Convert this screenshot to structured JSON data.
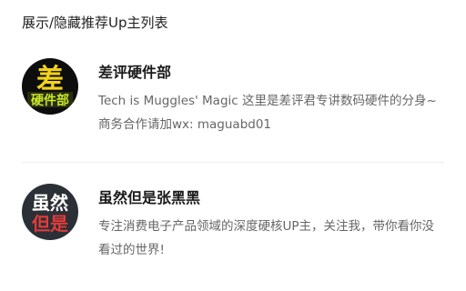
{
  "section": {
    "title": "展示/隐藏推荐Up主列表"
  },
  "ups": [
    {
      "name": "差评硬件部",
      "description": "Tech is Muggles' Magic 这里是差评君专讲数码硬件的分身~ 商务合作请加wx: maguabd01",
      "avatar": {
        "icon": "chaping-hardware-logo",
        "text_top": "差",
        "text_bottom": "硬件部",
        "background": "#0d0d0d",
        "accent": "#f2d21b",
        "accent2": "#c8e82a"
      }
    },
    {
      "name": "虽然但是张黑黑",
      "description": "专注消费电子产品领域的深度硬核UP主，关注我，带你看你没看过的世界!",
      "avatar": {
        "icon": "suiran-danshi-logo",
        "text_top": "虽然",
        "text_bottom": "但是",
        "background": "#2b2f36",
        "accent": "#ffffff",
        "accent2": "#e23b3b"
      }
    }
  ]
}
